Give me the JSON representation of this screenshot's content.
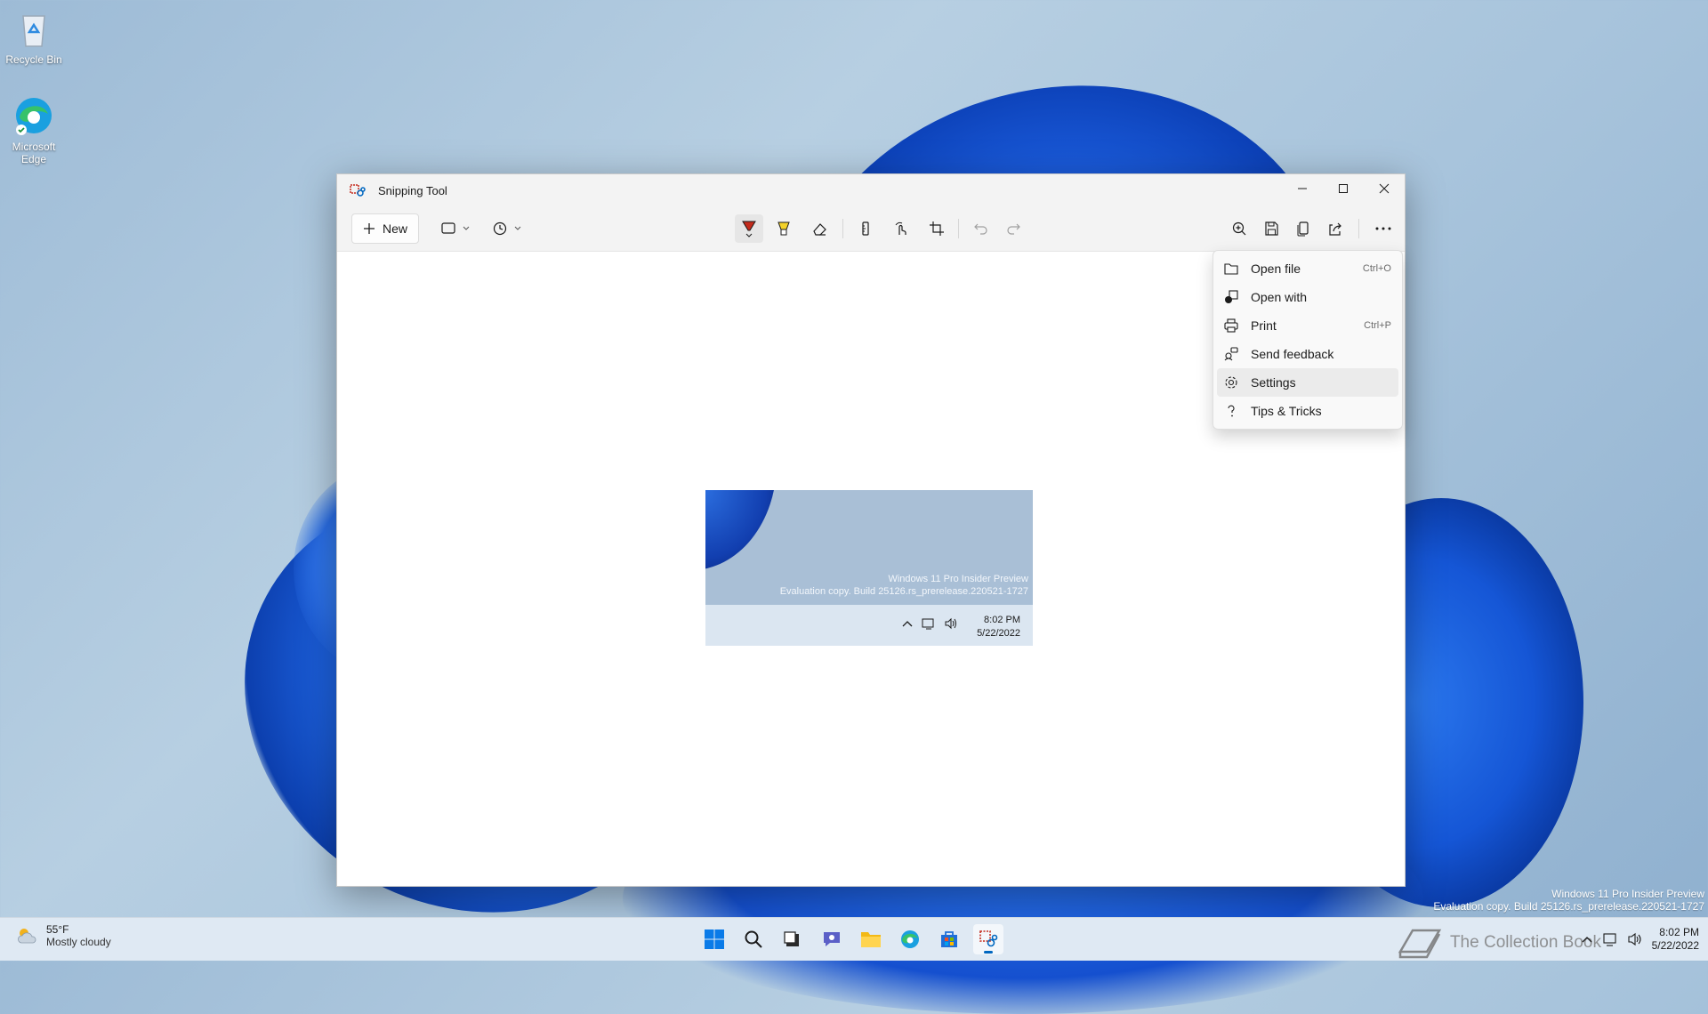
{
  "desktop": {
    "icons": [
      {
        "label": "Recycle Bin"
      },
      {
        "label": "Microsoft Edge"
      }
    ],
    "watermark": {
      "line1": "Windows 11 Pro Insider Preview",
      "line2": "Evaluation copy. Build 25126.rs_prerelease.220521-1727"
    }
  },
  "window": {
    "title": "Snipping Tool",
    "toolbar": {
      "new_label": "New"
    }
  },
  "preview": {
    "watermark_line1": "Windows 11 Pro Insider Preview",
    "watermark_line2": "Evaluation copy. Build 25126.rs_prerelease.220521-1727",
    "time": "8:02 PM",
    "date": "5/22/2022"
  },
  "menu": {
    "items": [
      {
        "label": "Open file",
        "shortcut": "Ctrl+O",
        "icon": "folder-icon"
      },
      {
        "label": "Open with",
        "shortcut": "",
        "icon": "open-with-icon"
      },
      {
        "label": "Print",
        "shortcut": "Ctrl+P",
        "icon": "printer-icon"
      },
      {
        "label": "Send feedback",
        "shortcut": "",
        "icon": "feedback-icon"
      },
      {
        "label": "Settings",
        "shortcut": "",
        "icon": "gear-icon"
      },
      {
        "label": "Tips & Tricks",
        "shortcut": "",
        "icon": "question-icon"
      }
    ]
  },
  "taskbar": {
    "weather_temp": "55°F",
    "weather_desc": "Mostly cloudy",
    "brand": "The Collection Book",
    "time": "8:02 PM",
    "date": "5/22/2022"
  },
  "colors": {
    "accent": "#0067c0",
    "bloom": "#1d5fe0"
  }
}
